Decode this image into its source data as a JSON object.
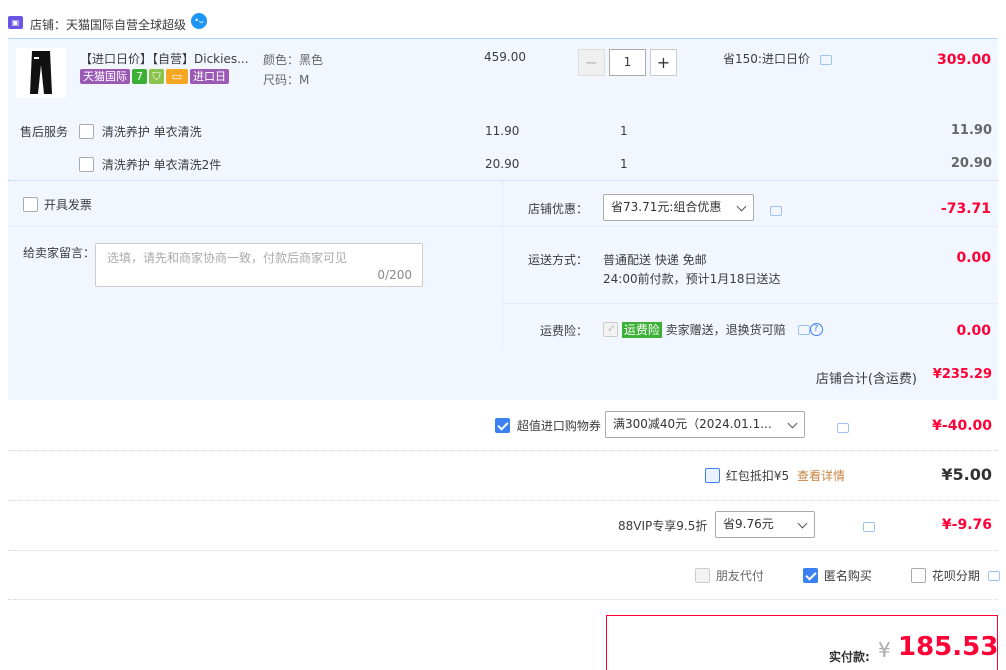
{
  "shop": {
    "label": "店铺：天猫国际自营全球超级",
    "shop_icon": "tmall-shop",
    "ww_icon": "wangwang"
  },
  "item": {
    "title": "【进口日价】【自营】Dickies...",
    "badges": {
      "tmall": "天猫国际",
      "seven": "7",
      "import": "进口日"
    },
    "sku_color": "颜色：黑色",
    "sku_size": "尺码：M",
    "unit_price": "459.00",
    "quantity": "1",
    "promo": "省150:进口日价",
    "total": "309.00"
  },
  "service": {
    "label": "售后服务",
    "options": [
      {
        "name": "清洗养护 单衣清洗",
        "price": "11.90",
        "qty": "1",
        "total": "11.90"
      },
      {
        "name": "清洗养护 单衣清洗2件",
        "price": "20.90",
        "qty": "1",
        "total": "20.90"
      }
    ]
  },
  "invoice": {
    "label": "开具发票"
  },
  "message": {
    "label": "给卖家留言：",
    "placeholder": "选填，请先和商家协商一致，付款后商家可见",
    "count": "0/200"
  },
  "shop_discount": {
    "label": "店铺优惠：",
    "selected": "省73.71元:组合优惠",
    "amount": "-73.71"
  },
  "shipping": {
    "label": "运送方式：",
    "line1": "普通配送 快递 免邮",
    "line2": "24:00前付款，预计1月18日送达",
    "amount": "0.00"
  },
  "insurance": {
    "label": "运费险：",
    "badge": "运费险",
    "text": "卖家赠送，退换货可赔",
    "amount": "0.00"
  },
  "shop_total": {
    "label": "店铺合计(含运费)",
    "amount": "¥235.29"
  },
  "coupon": {
    "label": "超值进口购物券",
    "selected": "满300减40元（2024.01.1...",
    "amount": "¥-40.00"
  },
  "redpacket": {
    "label": "红包抵扣¥5",
    "link": "查看详情",
    "amount": "¥5.00"
  },
  "vip": {
    "label": "88VIP专享9.5折",
    "selected": "省9.76元",
    "amount": "¥-9.76"
  },
  "options": {
    "friend_pay": "朋友代付",
    "anonymous": "匿名购买",
    "huabei": "花呗分期"
  },
  "final": {
    "label": "实付款:",
    "currency": "¥",
    "amount": "185.53"
  },
  "colors": {
    "accent": "#ff0036",
    "blue": "#3a80f2",
    "bg": "#f2f7ff"
  }
}
